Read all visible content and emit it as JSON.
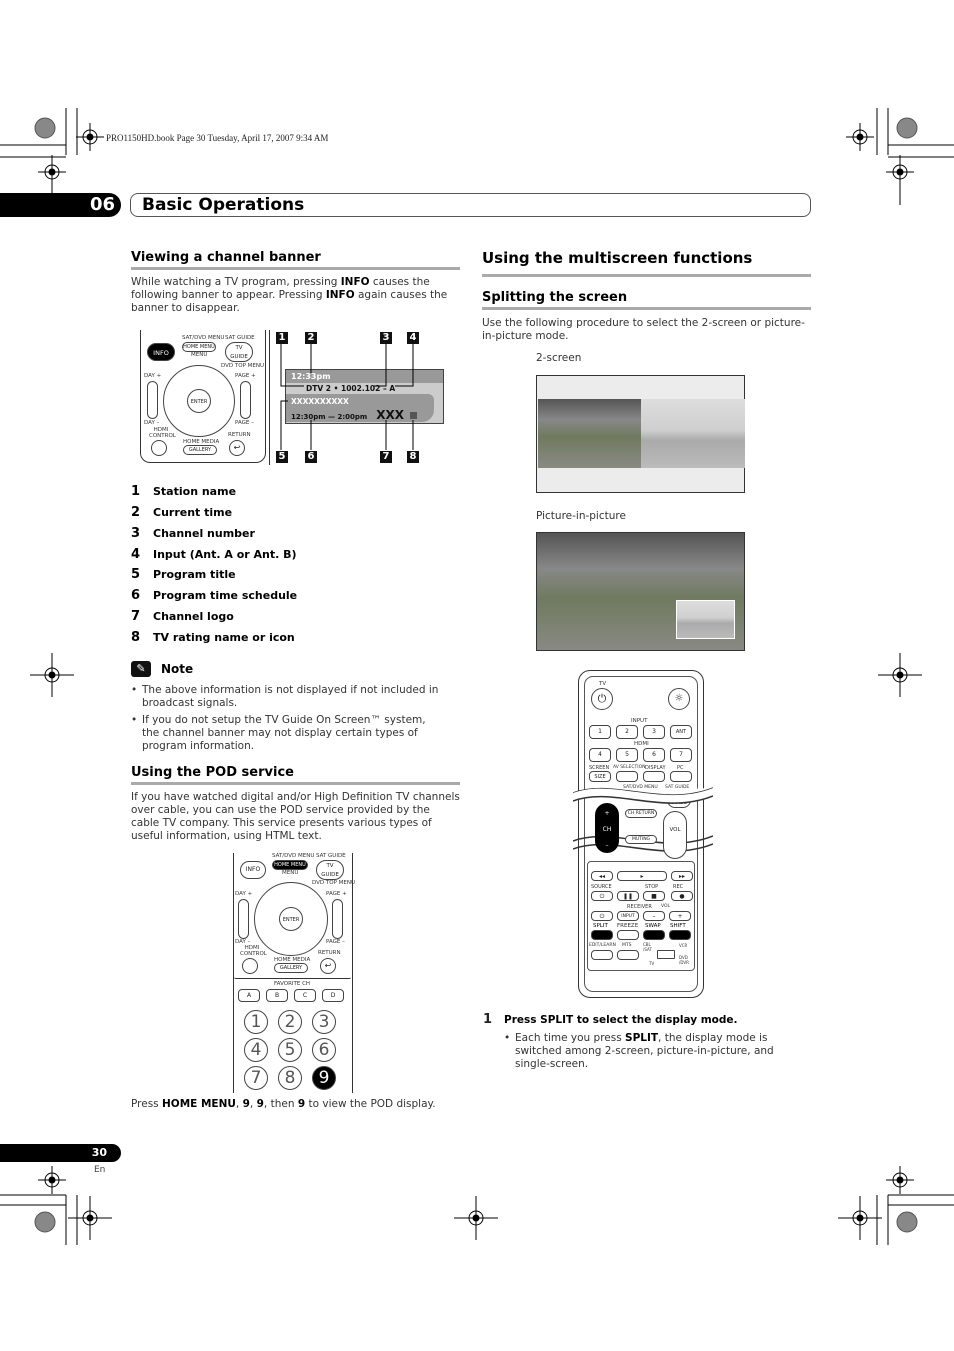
{
  "print_header": "PRO1150HD.book  Page 30  Tuesday, April 17, 2007  9:34 AM",
  "chapter": {
    "number": "06",
    "title": "Basic Operations"
  },
  "left": {
    "banner_heading": "Viewing a channel banner",
    "banner_para": [
      {
        "t": "While watching a TV program, pressing "
      },
      {
        "b": "INFO"
      },
      {
        "t": " causes the following banner to appear. Pressing "
      },
      {
        "b": "INFO"
      },
      {
        "t": " again causes the banner to disappear."
      }
    ],
    "banner": {
      "time": "12:33pm",
      "channel": "DTV 2 • 1002.102",
      "input": "A",
      "program": "XXXXXXXXXX",
      "schedule": "12:30pm — 2:00pm",
      "rating": "XXX",
      "callouts": [
        "1",
        "2",
        "3",
        "4",
        "5",
        "6",
        "7",
        "8"
      ]
    },
    "remote_small": {
      "info": "INFO",
      "sat_dvd_menu": "SAT/DVD MENU",
      "home_menu": "HOME MENU",
      "menu": "MENU",
      "sat_guide": "SAT GUIDE",
      "tv_guide": "TV GUIDE",
      "dvd_top_menu": "DVD TOP MENU",
      "day_plus": "DAY +",
      "day_minus": "DAY –",
      "page_plus": "PAGE +",
      "page_minus": "PAGE –",
      "enter": "ENTER",
      "hdmi_control": "HDMI CONTROL",
      "home_media": "HOME MEDIA",
      "gallery": "GALLERY",
      "return": "RETURN",
      "favorite_ch": "FAVORITE CH",
      "favorites": [
        "A",
        "B",
        "C",
        "D"
      ],
      "digits": [
        "1",
        "2",
        "3",
        "4",
        "5",
        "6",
        "7",
        "8",
        "9"
      ]
    },
    "items": [
      {
        "n": "1",
        "label": "Station name"
      },
      {
        "n": "2",
        "label": "Current time"
      },
      {
        "n": "3",
        "label": "Channel number"
      },
      {
        "n": "4",
        "label": "Input (Ant. A or Ant. B)"
      },
      {
        "n": "5",
        "label": "Program title"
      },
      {
        "n": "6",
        "label": "Program time schedule"
      },
      {
        "n": "7",
        "label": "Channel logo"
      },
      {
        "n": "8",
        "label": "TV rating name or icon"
      }
    ],
    "note_title": "Note",
    "notes": [
      "The above information is not displayed if not included in broadcast signals.",
      "If you do not setup the TV Guide On Screen™ system, the channel banner may not display certain types of program information."
    ],
    "pod_heading": "Using the POD service",
    "pod_para": "If you have watched digital and/or High Definition TV channels over cable, you can use the POD service provided by the cable TV company. This service presents various types of useful information, using HTML text.",
    "pod_caption": [
      {
        "t": "Press "
      },
      {
        "b": "HOME MENU"
      },
      {
        "t": ", "
      },
      {
        "b": "9"
      },
      {
        "t": ", "
      },
      {
        "b": "9"
      },
      {
        "t": ", then "
      },
      {
        "b": "9"
      },
      {
        "t": " to view the POD display."
      }
    ]
  },
  "right": {
    "title": "Using the multiscreen functions",
    "split_heading": "Splitting the screen",
    "split_para": "Use the following procedure to select the 2-screen or picture-in-picture mode.",
    "two_screen_label": "2-screen",
    "pip_label": "Picture-in-picture",
    "remote_large": {
      "tv": "TV",
      "input": "INPUT",
      "inputs": [
        "1",
        "2",
        "3",
        "ANT"
      ],
      "hdmi": "HDMI",
      "hdmis": [
        "4",
        "5",
        "6",
        "7"
      ],
      "screen": "SCREEN",
      "size": "SIZE",
      "av_selection": "AV SELECTION",
      "display": "DISPLAY",
      "pc": "PC",
      "sat_dvd_menu": "SAT/DVD MENU",
      "sat_guide": "SAT GUIDE",
      "tv_guide": "TV GUIDE",
      "ch": "CH",
      "ch_return": "CH RETURN",
      "muting": "MUTING",
      "vol": "VOL",
      "source": "SOURCE",
      "stop": "STOP",
      "rec": "REC",
      "receiver": "RECEIVER",
      "vol2": "VOL",
      "input_btn": "INPUT",
      "split": "SPLIT",
      "freeze": "FREEZE",
      "swap": "SWAP",
      "shift": "SHIFT",
      "edit_learn": "EDIT/LEARN",
      "mts": "MTS",
      "cbl_sat": "CBL /SAT",
      "vcr": "VCR",
      "tv_sw": "TV",
      "dvd_dvr": "DVD /DVR"
    },
    "step_num": "1",
    "step_text": "Press SPLIT to select the display mode.",
    "step_bullet": [
      {
        "t": "Each time you press "
      },
      {
        "b": "SPLIT"
      },
      {
        "t": ", the display mode is switched among 2-screen, picture-in-picture, and single-screen."
      }
    ]
  },
  "footer": {
    "page": "30",
    "lang": "En"
  }
}
